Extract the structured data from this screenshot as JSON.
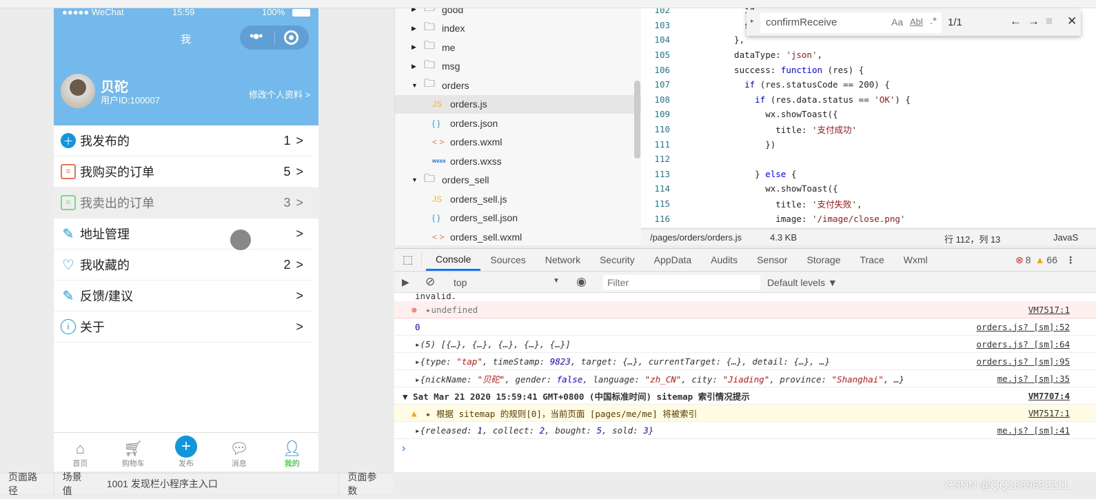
{
  "phone": {
    "status": {
      "carrier": "●●●●● WeChat",
      "time": "15:59",
      "battery": "100%"
    },
    "nav_title": "我",
    "profile": {
      "name": "贝砣",
      "user_id": "用户ID:100007",
      "edit": "修改个人资料 >"
    },
    "menu": [
      {
        "icon": "plus-circle-icon",
        "label": "我发布的",
        "count": "1"
      },
      {
        "icon": "order-list-icon",
        "label": "我购买的订单",
        "count": "5"
      },
      {
        "icon": "order-list-icon",
        "label": "我卖出的订单",
        "count": "3"
      },
      {
        "icon": "edit-icon",
        "label": "地址管理",
        "count": ""
      },
      {
        "icon": "heart-icon",
        "label": "我收藏的",
        "count": "2"
      },
      {
        "icon": "edit-icon",
        "label": "反馈/建议",
        "count": ""
      },
      {
        "icon": "info-icon",
        "label": "关于",
        "count": ""
      }
    ],
    "chevron": ">",
    "tabbar": [
      {
        "icon": "home-icon",
        "label": "首页"
      },
      {
        "icon": "cart-icon",
        "label": "购物车"
      },
      {
        "icon": "plus-circle-icon",
        "label": "发布"
      },
      {
        "icon": "message-icon",
        "label": "消息"
      },
      {
        "icon": "user-icon",
        "label": "我的",
        "active": true
      }
    ]
  },
  "bottom_status": {
    "path": "页面路径",
    "scene_label": "场景值",
    "scene_value": "1001 发现栏小程序主入口",
    "params": "页面参数"
  },
  "file_tree": [
    {
      "type": "folder",
      "name": "good",
      "open": false,
      "depth": 0
    },
    {
      "type": "folder",
      "name": "index",
      "open": false,
      "depth": 0
    },
    {
      "type": "folder",
      "name": "me",
      "open": false,
      "depth": 0
    },
    {
      "type": "folder",
      "name": "msg",
      "open": false,
      "depth": 0
    },
    {
      "type": "folder",
      "name": "orders",
      "open": true,
      "depth": 0
    },
    {
      "type": "js",
      "name": "orders.js",
      "depth": 1,
      "selected": true
    },
    {
      "type": "json",
      "name": "orders.json",
      "depth": 1
    },
    {
      "type": "wxml",
      "name": "orders.wxml",
      "depth": 1
    },
    {
      "type": "wxss",
      "name": "orders.wxss",
      "depth": 1
    },
    {
      "type": "folder",
      "name": "orders_sell",
      "open": true,
      "depth": 0
    },
    {
      "type": "js",
      "name": "orders_sell.js",
      "depth": 1
    },
    {
      "type": "json",
      "name": "orders_sell.json",
      "depth": 1
    },
    {
      "type": "wxml",
      "name": "orders_sell.wxml",
      "depth": 1
    }
  ],
  "editor": {
    "lines": [
      {
        "n": "102",
        "code": "    id"
      },
      {
        "n": "103",
        "code": "    st"
      },
      {
        "n": "104",
        "code": "  },"
      },
      {
        "n": "105",
        "code": "  dataType: 'json',"
      },
      {
        "n": "106",
        "code": "  success: function (res) {"
      },
      {
        "n": "107",
        "code": "    if (res.statusCode == 200) {"
      },
      {
        "n": "108",
        "code": "      if (res.data.status == 'OK') {"
      },
      {
        "n": "109",
        "code": "        wx.showToast({"
      },
      {
        "n": "110",
        "code": "          title: '支付成功'"
      },
      {
        "n": "111",
        "code": "        })"
      },
      {
        "n": "112",
        "code": ""
      },
      {
        "n": "113",
        "code": "      } else {"
      },
      {
        "n": "114",
        "code": "        wx.showToast({"
      },
      {
        "n": "115",
        "code": "          title: '支付失败',"
      },
      {
        "n": "116",
        "code": "          image: '/image/close.png'"
      }
    ],
    "find": {
      "value": "confirmReceive",
      "case": "Aa",
      "word": "Abl",
      "regex": ".*",
      "count": "1/1"
    },
    "status": {
      "path": "/pages/orders/orders.js",
      "size": "4.3 KB",
      "pos": "行 112，列 13",
      "lang": "JavaS"
    }
  },
  "devtools": {
    "tabs": [
      "Console",
      "Sources",
      "Network",
      "Security",
      "AppData",
      "Audits",
      "Sensor",
      "Storage",
      "Trace",
      "Wxml"
    ],
    "errors": "8",
    "warnings": "66",
    "context": "top",
    "filter_placeholder": "Filter",
    "levels": "Default levels ▼",
    "rows": [
      {
        "kind": "plain",
        "text": "invalid.",
        "src": ""
      },
      {
        "kind": "err",
        "text": "▸undefined",
        "src": "VM7517:1"
      },
      {
        "kind": "num",
        "text": "0",
        "src": "orders.js? [sm]:52"
      },
      {
        "kind": "obj",
        "text": "▸(5) [{…}, {…}, {…}, {…}, {…}]",
        "src": "orders.js? [sm]:64"
      },
      {
        "kind": "obj",
        "text": "▸{type: \"tap\", timeStamp: 9823, target: {…}, currentTarget: {…}, detail: {…}, …}",
        "src": "orders.js? [sm]:95"
      },
      {
        "kind": "obj",
        "text": "▸{nickName: \"贝砣\", gender: false, language: \"zh_CN\", city: \"Jiading\", province: \"Shanghai\", …}",
        "src": "me.js? [sm]:35"
      },
      {
        "kind": "group",
        "text": "▼ Sat Mar 21 2020 15:59:41 GMT+0800 (中国标准时间) sitemap 索引情况提示",
        "src": "VM7707:4"
      },
      {
        "kind": "warn",
        "text": "▸ 根据 sitemap 的规则[0]，当前页面 [pages/me/me] 将被索引",
        "src": "VM7517:1"
      },
      {
        "kind": "obj",
        "text": "▸{released: 1, collect: 2, bought: 5, sold: 3}",
        "src": "me.js? [sm]:41"
      }
    ],
    "prompt": "›"
  },
  "watermark": "CSDN @QQ1039692211",
  "colors": {
    "header_blue": "#74b9ec",
    "accent_blue": "#1296db",
    "active_tab": "#09bb07"
  }
}
